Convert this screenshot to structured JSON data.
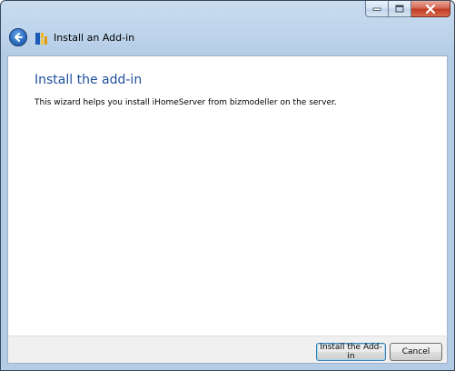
{
  "window": {
    "title": "Install an Add-in"
  },
  "titlebar": {
    "buttons": [
      "minimize",
      "maximize",
      "close"
    ]
  },
  "icons": {
    "back": "back-arrow-icon",
    "app": "add-in-icon",
    "minimize": "minimize-icon",
    "maximize": "maximize-icon",
    "close": "close-icon"
  },
  "main": {
    "heading": "Install the add-in",
    "description": "This wizard helps you install iHomeServer from bizmodeller on the server."
  },
  "footer": {
    "install_label": "Install the Add-in",
    "cancel_label": "Cancel"
  },
  "colors": {
    "heading": "#1e4f9e",
    "titlebar": "#bcd3ea",
    "close_button": "#c03a23"
  }
}
